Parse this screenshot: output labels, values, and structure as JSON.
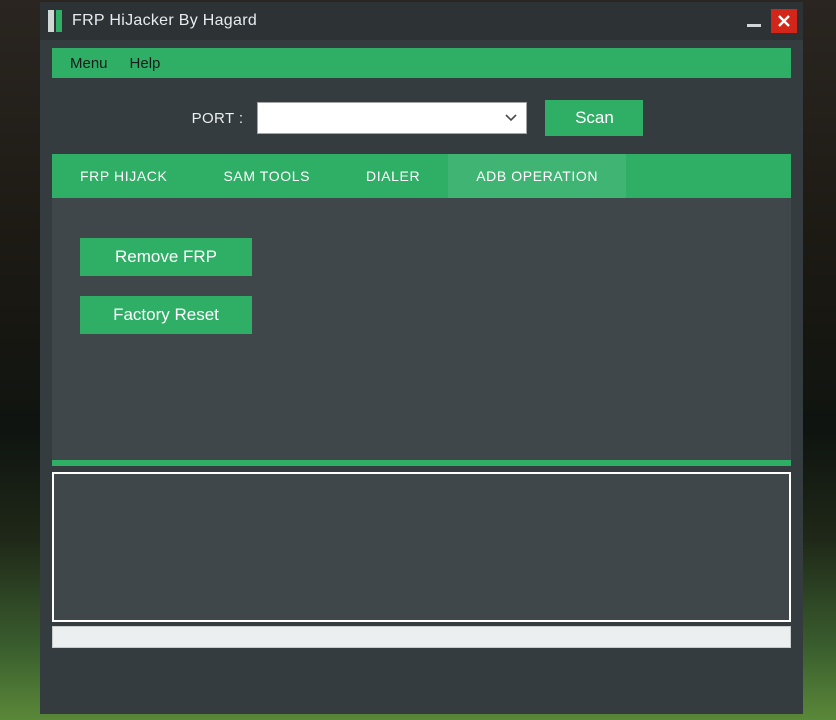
{
  "titlebar": {
    "title": "FRP HiJacker By Hagard"
  },
  "menubar": {
    "menu": "Menu",
    "help": "Help"
  },
  "port": {
    "label": "PORT :",
    "scan": "Scan"
  },
  "tabs": {
    "frp_hijack": "FRP HIJACK",
    "sam_tools": "SAM TOOLS",
    "dialer": "DIALER",
    "adb_operation": "ADB OPERATION"
  },
  "actions": {
    "remove_frp": "Remove FRP",
    "factory_reset": "Factory Reset"
  }
}
